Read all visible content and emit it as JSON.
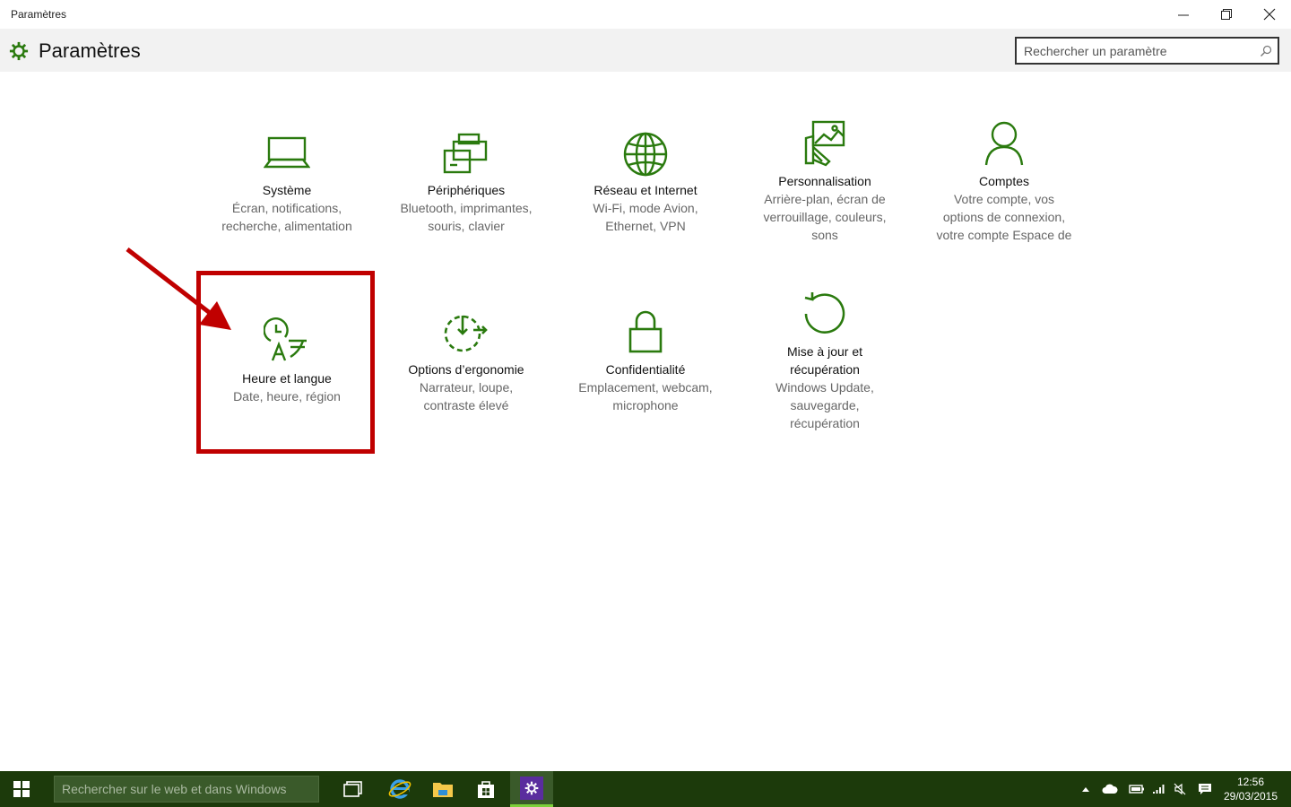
{
  "window": {
    "title": "Paramètres"
  },
  "header": {
    "title": "Paramètres",
    "search_placeholder": "Rechercher un paramètre"
  },
  "tiles": [
    {
      "name": "Système",
      "desc": [
        "Écran, notifications,",
        "recherche, alimentation"
      ],
      "icon": "laptop-icon"
    },
    {
      "name": "Périphériques",
      "desc": [
        "Bluetooth, imprimantes,",
        "souris, clavier"
      ],
      "icon": "devices-icon"
    },
    {
      "name": "Réseau et Internet",
      "desc": [
        "Wi-Fi, mode Avion,",
        "Ethernet, VPN"
      ],
      "icon": "globe-icon"
    },
    {
      "name": "Personnalisation",
      "desc": [
        "Arrière-plan, écran de",
        "verrouillage, couleurs,",
        "sons"
      ],
      "icon": "personalization-icon"
    },
    {
      "name": "Comptes",
      "desc": [
        "Votre compte, vos",
        "options de connexion,",
        "votre compte Espace de"
      ],
      "icon": "person-icon"
    },
    {
      "name": "Heure et langue",
      "desc": [
        "Date, heure, région"
      ],
      "icon": "time-language-icon"
    },
    {
      "name": "Options d’ergonomie",
      "desc": [
        "Narrateur, loupe,",
        "contraste élevé"
      ],
      "icon": "ease-of-access-icon"
    },
    {
      "name": "Confidentialité",
      "desc": [
        "Emplacement, webcam,",
        "microphone"
      ],
      "icon": "lock-icon"
    },
    {
      "name": [
        "Mise à jour et",
        "récupération"
      ],
      "desc": [
        "Windows Update,",
        "sauvegarde,",
        "récupération"
      ],
      "icon": "update-icon"
    }
  ],
  "taskbar": {
    "search_placeholder": "Rechercher sur le web et dans Windows",
    "time": "12:56",
    "date": "29/03/2015"
  },
  "colors": {
    "accent": "#2a7a0e",
    "taskbar": "#1c3a0b",
    "highlight": "#c00000"
  }
}
